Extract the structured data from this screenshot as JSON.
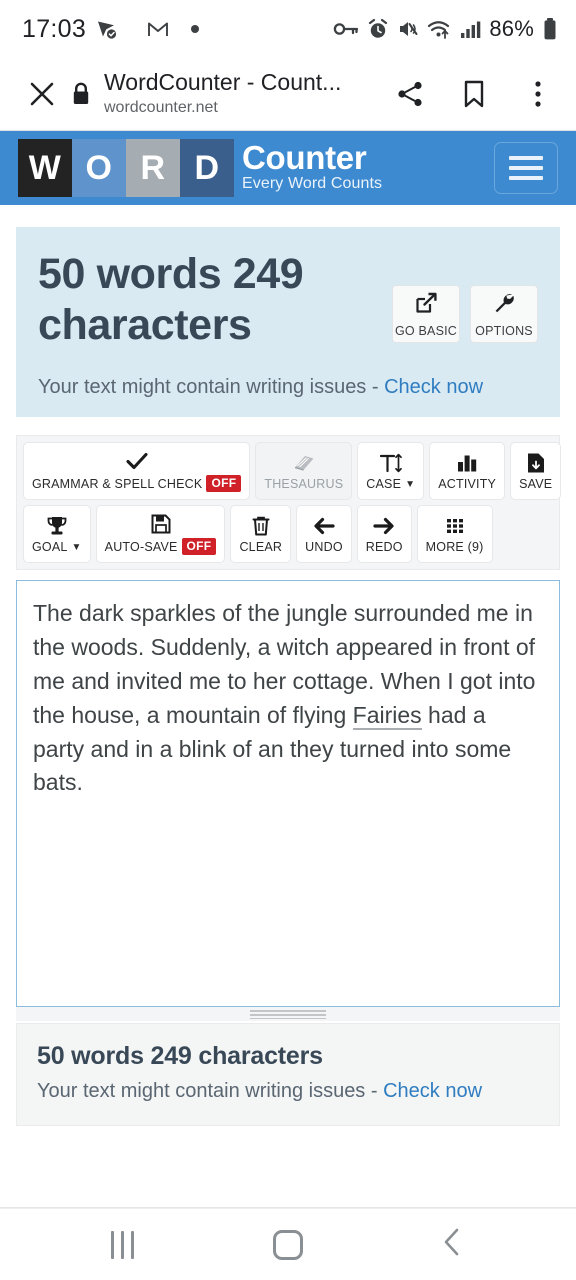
{
  "statusbar": {
    "time": "17:03",
    "battery": "86%",
    "left_icons": [
      "location-arrow-check-icon",
      "gmail-icon",
      "dot-icon"
    ],
    "right_icons": [
      "vpn-key-icon",
      "alarm-icon",
      "mute-vibrate-icon",
      "wifi-icon",
      "signal-bars-icon",
      "battery-icon"
    ]
  },
  "browser": {
    "close_label": "✕",
    "title": "WordCounter - Count...",
    "url": "wordcounter.net",
    "icons": [
      "lock-icon",
      "share-icon",
      "bookmark-icon",
      "overflow-menu-icon"
    ]
  },
  "site_header": {
    "tiles": [
      "W",
      "O",
      "R",
      "D"
    ],
    "logo_main": "Counter",
    "logo_sub": "Every Word Counts",
    "menu_label": "menu",
    "bg_color": "#3d8ad1",
    "tile_colors": [
      "#232323",
      "#5e93cc",
      "#a5acb2",
      "#3a5f8d"
    ]
  },
  "stats": {
    "counts": "50 words 249 characters",
    "issues_text": "Your text might contain writing issues - ",
    "issues_link": "Check now",
    "buttons": [
      {
        "label": "GO BASIC",
        "icon": "external-link-icon"
      },
      {
        "label": "OPTIONS",
        "icon": "wrench-icon"
      }
    ],
    "panel_color": "#daeaf3",
    "link_color": "#2f7dc0"
  },
  "toolbar": {
    "row1": [
      {
        "label": "GRAMMAR & SPELL CHECK",
        "badge": "OFF",
        "icon": "checkmark-icon",
        "disabled": false,
        "caret": false,
        "name": "grammar-spell-check-button"
      },
      {
        "label": "THESAURUS",
        "badge": "",
        "icon": "book-icon",
        "disabled": true,
        "caret": false,
        "name": "thesaurus-button"
      },
      {
        "label": "CASE",
        "badge": "",
        "icon": "text-size-icon",
        "disabled": false,
        "caret": true,
        "name": "case-button"
      },
      {
        "label": "ACTIVITY",
        "badge": "",
        "icon": "bar-chart-icon",
        "disabled": false,
        "caret": false,
        "name": "activity-button"
      },
      {
        "label": "SAVE",
        "badge": "",
        "icon": "save-download-icon",
        "disabled": false,
        "caret": false,
        "name": "save-button"
      }
    ],
    "row2": [
      {
        "label": "GOAL",
        "badge": "",
        "icon": "trophy-icon",
        "disabled": false,
        "caret": true,
        "name": "goal-button"
      },
      {
        "label": "AUTO-SAVE",
        "badge": "OFF",
        "icon": "floppy-disk-icon",
        "disabled": false,
        "caret": false,
        "name": "auto-save-button"
      },
      {
        "label": "CLEAR",
        "badge": "",
        "icon": "trash-icon",
        "disabled": false,
        "caret": false,
        "name": "clear-button"
      },
      {
        "label": "UNDO",
        "badge": "",
        "icon": "arrow-left-icon",
        "disabled": false,
        "caret": false,
        "name": "undo-button"
      },
      {
        "label": "REDO",
        "badge": "",
        "icon": "arrow-right-icon",
        "disabled": false,
        "caret": false,
        "name": "redo-button"
      },
      {
        "label": "MORE (9)",
        "badge": "",
        "icon": "grid-dots-icon",
        "disabled": false,
        "caret": false,
        "name": "more-button"
      }
    ],
    "badge_color": "#cf2127"
  },
  "editor": {
    "text_before": "The dark sparkles of the jungle surrounded me in the woods. Suddenly, a witch appeared in front of me and invited me to her cottage. When I got into the house, a mountain of flying ",
    "misspelled_word": "Fairies",
    "text_after": " had a party and in a blink of an they turned into some bats.",
    "full_text": "The dark sparkles of the jungle surrounded me in the woods. Suddenly, a witch appeared in front of me and invited me to her cottage. When I got into the house, a mountain of flying Fairies had a party and in a blink of an they turned into some bats.",
    "border_color": "#8cbcdd"
  },
  "bottom_stats": {
    "counts": "50 words 249 characters",
    "issues_text": "Your text might contain writing issues - ",
    "issues_link": "Check now"
  },
  "navbar": {
    "items": [
      "recents-button",
      "home-button",
      "back-button"
    ]
  }
}
